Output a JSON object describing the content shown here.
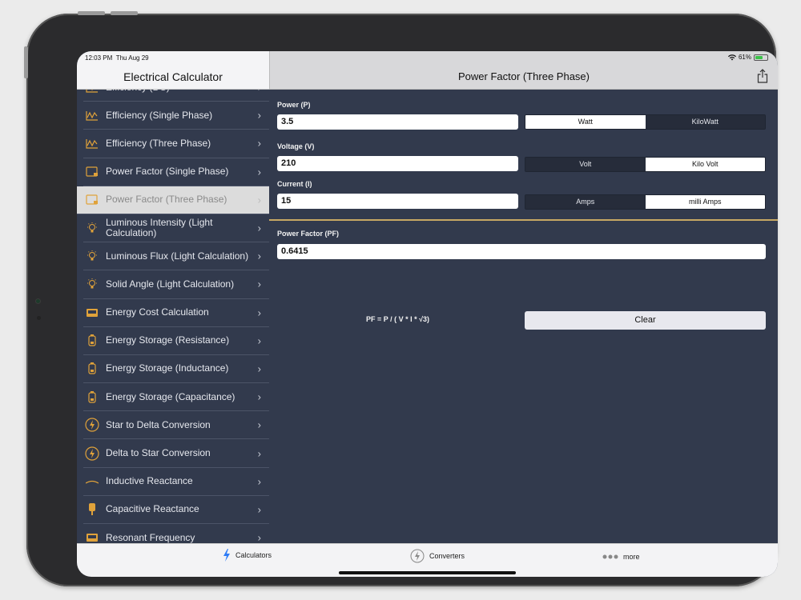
{
  "status": {
    "time": "12:03 PM",
    "date": "Thu Aug 29",
    "battery": "61%",
    "battery_level": 0.61
  },
  "sidebar": {
    "title": "Electrical Calculator",
    "items": [
      {
        "label": "Efficiency (DC)",
        "icon": "efficiency-icon"
      },
      {
        "label": "Efficiency (Single Phase)",
        "icon": "efficiency-icon"
      },
      {
        "label": "Efficiency (Three Phase)",
        "icon": "efficiency-icon"
      },
      {
        "label": "Power Factor (Single Phase)",
        "icon": "power-factor-icon"
      },
      {
        "label": "Power Factor (Three Phase)",
        "icon": "power-factor-icon",
        "selected": true
      },
      {
        "label": "Luminous Intensity (Light Calculation)",
        "icon": "bulb-icon"
      },
      {
        "label": "Luminous Flux (Light Calculation)",
        "icon": "bulb-icon"
      },
      {
        "label": "Solid Angle (Light Calculation)",
        "icon": "bulb-icon"
      },
      {
        "label": "Energy Cost Calculation",
        "icon": "meter-icon"
      },
      {
        "label": "Energy Storage (Resistance)",
        "icon": "battery-icon"
      },
      {
        "label": "Energy Storage (Inductance)",
        "icon": "battery-icon"
      },
      {
        "label": "Energy Storage (Capacitance)",
        "icon": "battery-icon"
      },
      {
        "label": "Star to Delta Conversion",
        "icon": "bolt-circle-icon"
      },
      {
        "label": "Delta to Star Conversion",
        "icon": "bolt-circle-icon"
      },
      {
        "label": "Inductive Reactance",
        "icon": "inductor-icon"
      },
      {
        "label": "Capacitive Reactance",
        "icon": "capacitor-icon"
      },
      {
        "label": "Resonant Frequency",
        "icon": "meter-icon"
      }
    ]
  },
  "detail": {
    "title": "Power Factor (Three Phase)",
    "power": {
      "label": "Power (P)",
      "value": "3.5",
      "units": [
        "Watt",
        "KiloWatt"
      ],
      "selected": 0
    },
    "voltage": {
      "label": "Voltage (V)",
      "value": "210",
      "units": [
        "Volt",
        "Kilo Volt"
      ],
      "selected": 1
    },
    "current": {
      "label": "Current (I)",
      "value": "15",
      "units": [
        "Amps",
        "milli Amps"
      ],
      "selected": 1
    },
    "result": {
      "label": "Power Factor (PF)",
      "value": "0.6415"
    },
    "formula": "PF = P / ( V * I * √3)",
    "clear_label": "Clear"
  },
  "tabbar": {
    "calculators": "Calculators",
    "converters": "Converters",
    "more": "more"
  },
  "colors": {
    "background": "#323a4d",
    "accent": "#e0a23a",
    "divider": "#c7a864"
  }
}
